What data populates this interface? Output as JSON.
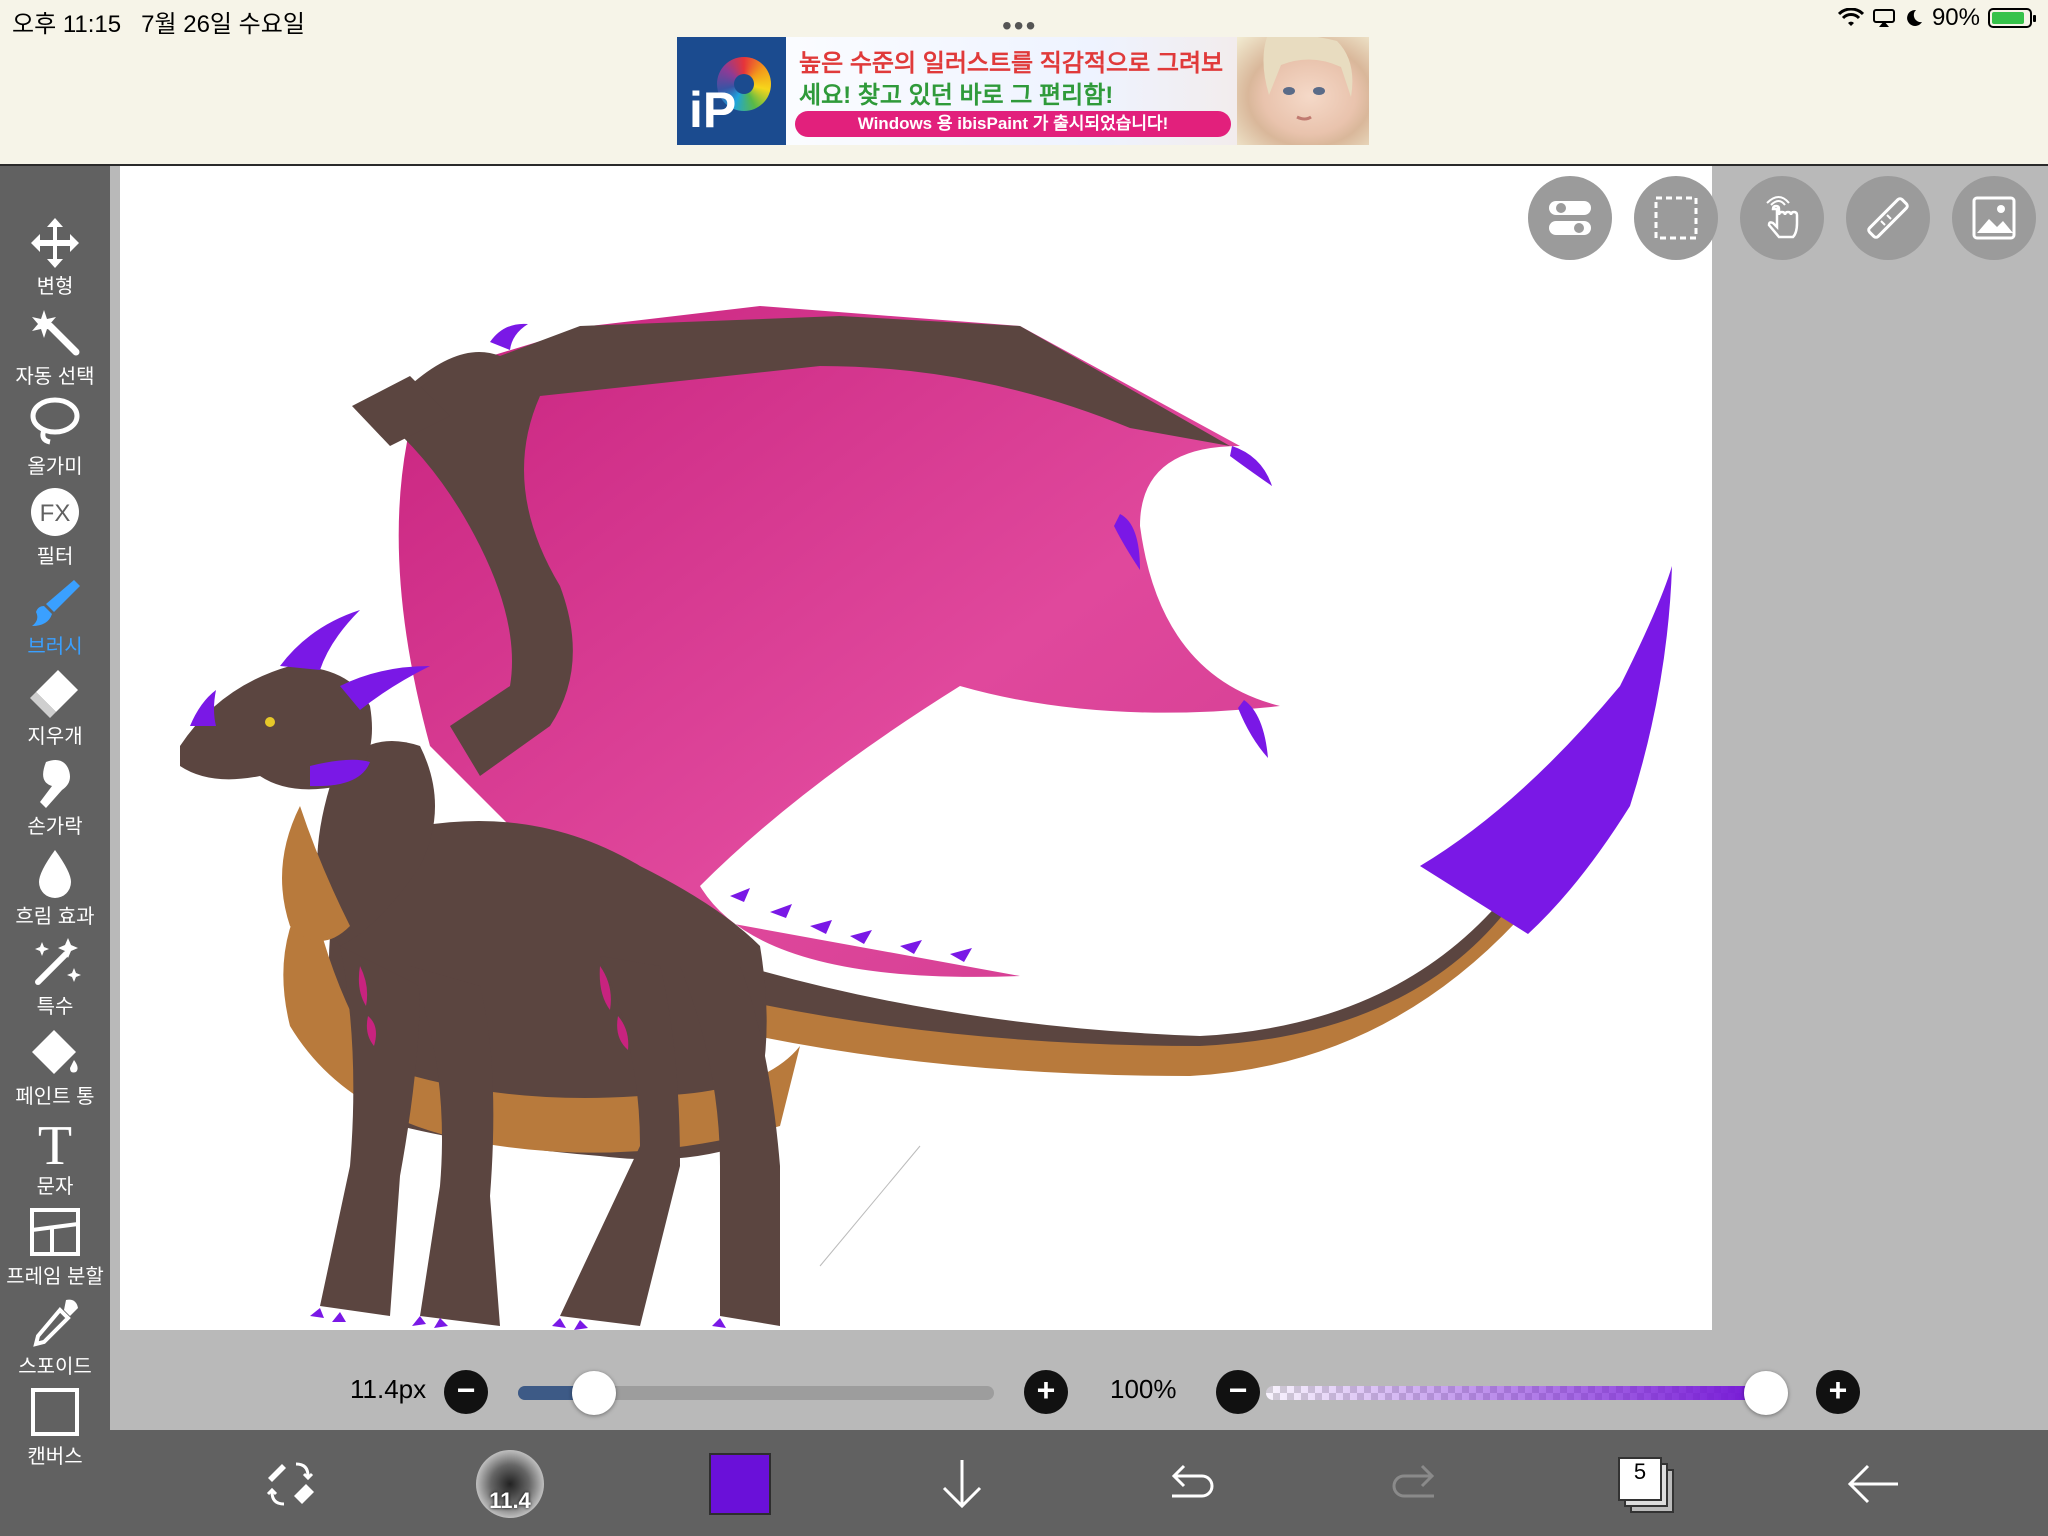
{
  "status": {
    "time": "오후 11:15",
    "date": "7월 26일 수요일",
    "battery": "90%",
    "battery_level": 0.9,
    "multitask_dots": "•••"
  },
  "ad": {
    "line1": "높은 수준의 일러스트를 직감적으로 그려보",
    "line2": "세요! 찾고 있던 바로 그 편리함!",
    "pill": "Windows 용 ibisPaint 가 출시되었습니다!",
    "logo_text": "iP"
  },
  "tools": [
    {
      "label": "변형",
      "icon": "move-arrows-icon"
    },
    {
      "label": "자동 선택",
      "icon": "magic-wand-icon"
    },
    {
      "label": "올가미",
      "icon": "lasso-icon"
    },
    {
      "label": "필터",
      "icon": "fx-filter-icon",
      "glyph": "FX"
    },
    {
      "label": "브러시",
      "icon": "brush-icon",
      "active": true
    },
    {
      "label": "지우개",
      "icon": "eraser-icon"
    },
    {
      "label": "손가락",
      "icon": "smudge-finger-icon"
    },
    {
      "label": "흐림 효과",
      "icon": "blur-drop-icon"
    },
    {
      "label": "특수",
      "icon": "special-sparkle-icon"
    },
    {
      "label": "페인트 통",
      "icon": "paint-bucket-icon"
    },
    {
      "label": "문자",
      "icon": "text-icon",
      "glyph": "T"
    },
    {
      "label": "프레임 분할",
      "icon": "frame-divider-icon"
    },
    {
      "label": "스포이드",
      "icon": "eyedropper-icon"
    },
    {
      "label": "캔버스",
      "icon": "canvas-icon"
    }
  ],
  "brush_size": {
    "label": "11.4px",
    "value": 11.4,
    "slider_fraction": 0.16
  },
  "opacity": {
    "label": "100%",
    "value": 1.0
  },
  "bottom": {
    "brush_preview_value": "11.4",
    "layer_count": "5",
    "color": "#6a10d9"
  },
  "colors": {
    "toolbar_bg": "#616161",
    "active_accent": "#3aa0ff",
    "wing_pink": "#d8348e",
    "body_brown": "#55403a",
    "belly_tan": "#b87a3c",
    "accent_purple": "#7a18e6"
  }
}
